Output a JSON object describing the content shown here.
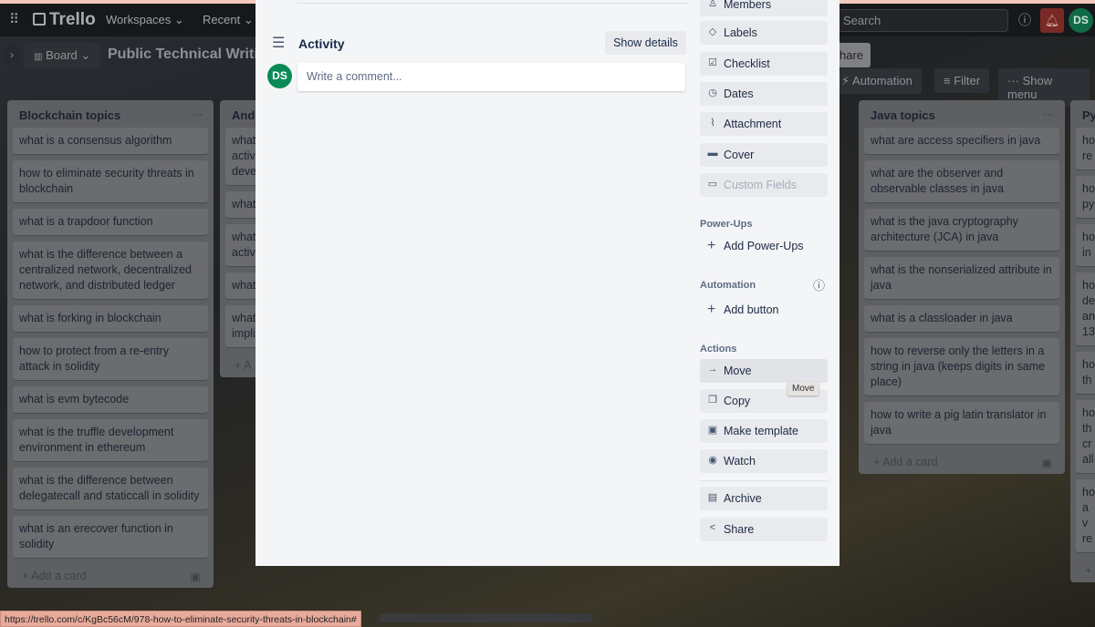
{
  "header": {
    "app_name": "Trello",
    "workspaces": "Workspaces",
    "recent": "Recent",
    "search_placeholder": "Search",
    "avatar": "DS"
  },
  "board": {
    "view": "Board",
    "title": "Public Technical Writin",
    "share": "hare",
    "automation": "Automation",
    "filter": "Filter",
    "show_menu": "Show menu"
  },
  "lists": [
    {
      "title": "Blockchain topics",
      "cards": [
        "what is a consensus algorithm",
        "how to eliminate security threats in blockchain",
        "what is a trapdoor function",
        "what is the difference between a centralized network, decentralized network, and distributed ledger",
        "what is forking in blockchain",
        "how to protect from a re-entry attack in solidity",
        "what is evm bytecode",
        "what is the truffle development environment in ethereum",
        "what is the difference between delegatecall and staticcall in solidity",
        "what is an erecover function in solidity"
      ],
      "add": "Add a card"
    },
    {
      "title": "Andr",
      "cards": [
        "what activ deve",
        "what",
        "what activ",
        "what",
        "what impli"
      ],
      "add": "A"
    },
    {
      "title": "Java topics",
      "cards": [
        "what are access specifiers in java",
        "what are the observer and observable classes in java",
        "what is the java cryptography architecture (JCA) in java",
        "what is the nonserialized attribute in java",
        "what is a classloader in java",
        "how to reverse only the letters in a string in java (keeps digits in same place)",
        "how to write a pig latin translator in java"
      ],
      "add": "Add a card"
    },
    {
      "title": "Py",
      "cards": [
        "ho re",
        "ho py",
        "ho in",
        "ho de an 13",
        "ho th",
        "ho th cr all",
        "ho a v re"
      ],
      "add": ""
    }
  ],
  "modal": {
    "activity_title": "Activity",
    "show_details": "Show details",
    "avatar": "DS",
    "comment_placeholder": "Write a comment...",
    "add_to": [
      {
        "label": "Members",
        "icon": "person-icon"
      },
      {
        "label": "Labels",
        "icon": "tag-icon"
      },
      {
        "label": "Checklist",
        "icon": "checklist-icon"
      },
      {
        "label": "Dates",
        "icon": "clock-icon"
      },
      {
        "label": "Attachment",
        "icon": "paperclip-icon"
      },
      {
        "label": "Cover",
        "icon": "cover-icon"
      },
      {
        "label": "Custom Fields",
        "icon": "custom-fields-icon",
        "disabled": true
      }
    ],
    "powerups_title": "Power-Ups",
    "add_powerups": "Add Power-Ups",
    "automation_title": "Automation",
    "add_button": "Add button",
    "actions_title": "Actions",
    "actions": [
      {
        "label": "Move",
        "icon": "arrow-right-icon"
      },
      {
        "label": "Copy",
        "icon": "copy-icon"
      },
      {
        "label": "Make template",
        "icon": "template-icon"
      },
      {
        "label": "Watch",
        "icon": "eye-icon"
      },
      {
        "label": "Archive",
        "icon": "archive-icon"
      },
      {
        "label": "Share",
        "icon": "share-icon"
      }
    ],
    "tooltip": "Move"
  },
  "status_url": "https://trello.com/c/KgBc56cM/978-how-to-eliminate-security-threats-in-blockchain#"
}
